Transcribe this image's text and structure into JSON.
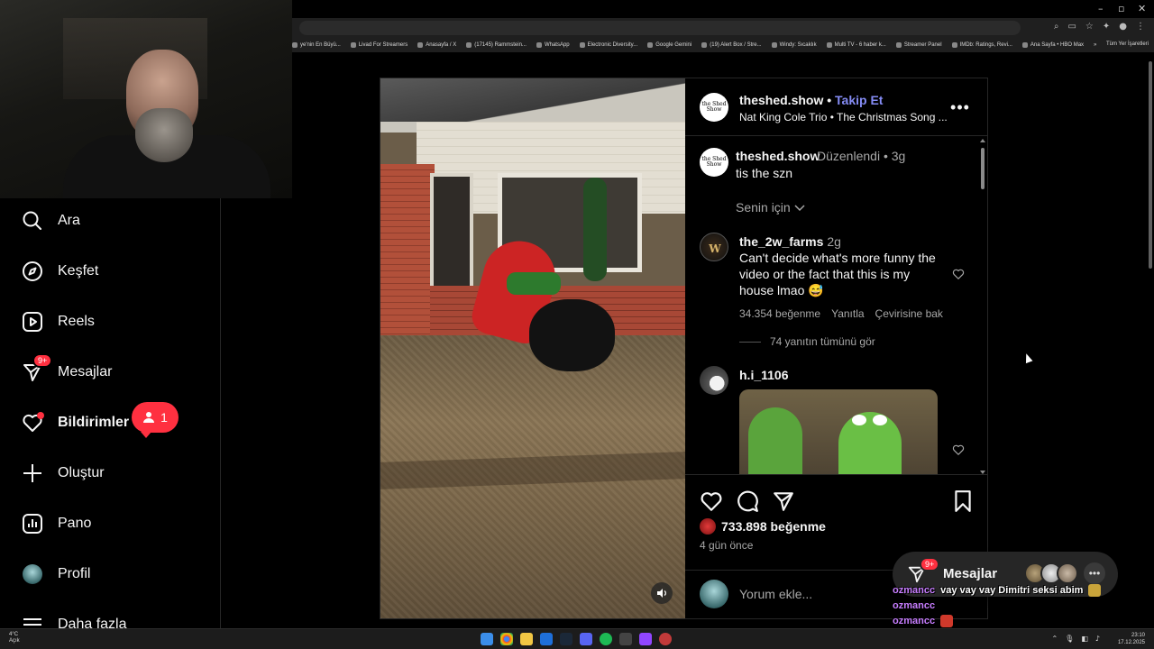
{
  "browser": {
    "window_controls": [
      "–",
      "▫",
      "✕"
    ],
    "bookmarks": [
      "ye'nin En Büyü...",
      "Livad For Streamers",
      "Anasayfa / X",
      "(17145) Rammstein...",
      "WhatsApp",
      "Electronic Diversity...",
      "Google Gemini",
      "(19) Alert Box / Stre...",
      "Windy: Sıcaklık",
      "Multi TV - 6 haber k...",
      "Streamer Panel",
      "IMDb: Ratings, Revi...",
      "Ana Sayfa • HBO Max"
    ],
    "bookmarks_overflow": "»",
    "all_bookmarks": "Tüm Yer İşaretleri"
  },
  "sidebar": {
    "items": [
      {
        "label": "Ara",
        "icon": "search-icon"
      },
      {
        "label": "Keşfet",
        "icon": "compass-icon"
      },
      {
        "label": "Reels",
        "icon": "reels-icon"
      },
      {
        "label": "Mesajlar",
        "icon": "messenger-icon",
        "badge": "9+"
      },
      {
        "label": "Bildirimler",
        "icon": "heart-icon"
      },
      {
        "label": "Oluştur",
        "icon": "plus-icon"
      },
      {
        "label": "Pano",
        "icon": "dashboard-icon"
      },
      {
        "label": "Profil",
        "icon": "profile-avatar"
      },
      {
        "label": "Daha fazla",
        "icon": "menu-icon"
      }
    ],
    "notification_bubble": {
      "count": "1"
    }
  },
  "post": {
    "avatar_text": "the Shed Show",
    "username": "theshed.show",
    "separator": "•",
    "follow_label": "Takip Et",
    "song": "Nat King Cole Trio • The Christmas Song ...",
    "more": "•••",
    "caption": {
      "username": "theshed.show",
      "edited": "Düzenlendi • 3g",
      "text": "tis the szn"
    },
    "for_you": "Senin için",
    "comments": [
      {
        "username": "the_2w_farms",
        "time": "2g",
        "text": "Can't decide what's more funny the video or the fact that this is my house lmao 😅",
        "likes": "34.354 beğenme",
        "reply": "Yanıtla",
        "translate": "Çevirisine bak"
      },
      {
        "username": "h.i_1106",
        "time": ""
      }
    ],
    "view_replies": "74 yanıtın tümünü gör",
    "likes": "733.898 beğenme",
    "date": "4 gün önce",
    "comment_placeholder": "Yorum ekle..."
  },
  "messages_pill": {
    "label": "Mesajlar",
    "badge": "9+"
  },
  "stream_chat": [
    {
      "user": "ozmancc",
      "message": "vay vay vay Dimitri seksi abim",
      "emote_color": "#c9a43a"
    },
    {
      "user": "ozmancc",
      "message": "",
      "emote_color": ""
    },
    {
      "user": "ozmancc",
      "message": "",
      "emote_color": "#d0392b"
    },
    {
      "user": "ozmancc",
      "message": "",
      "emote_color": "#8a3fd1"
    }
  ],
  "taskbar": {
    "weather_temp": "4°C",
    "weather_desc": "Açık",
    "time": "23:10",
    "date": "17.12.2025"
  },
  "colors": {
    "accent_follow": "#858cf5",
    "notification_red": "#ff3040",
    "background": "#000000",
    "muted_text": "#a8a8a8"
  }
}
